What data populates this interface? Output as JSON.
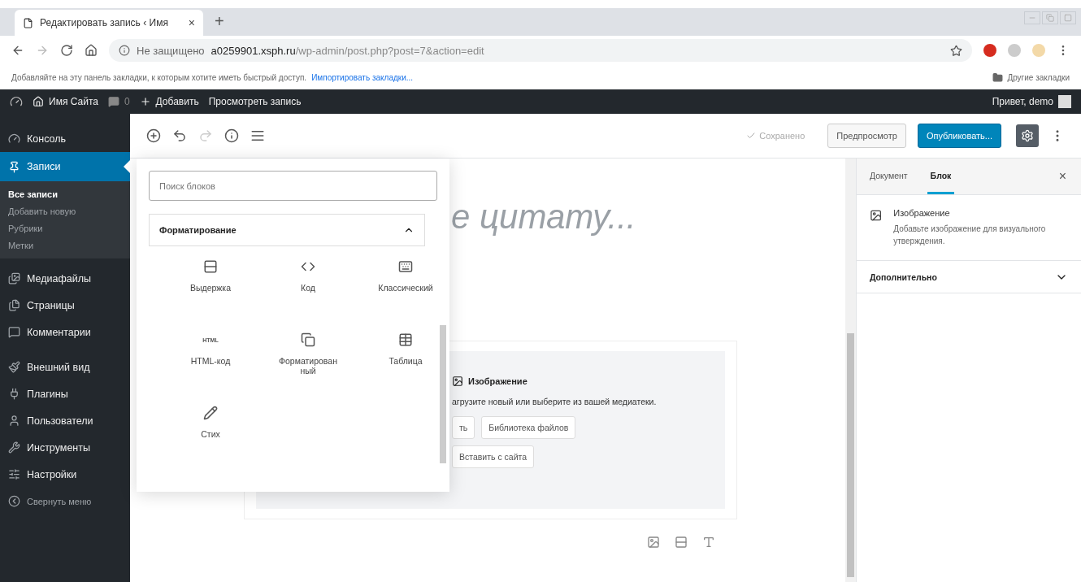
{
  "browser": {
    "tab": {
      "title": "Редактировать запись ‹ Имя",
      "close": "×",
      "selected": true
    },
    "new_tab": "+",
    "address": {
      "security": "Не защищено",
      "host": "a0259901.xsph.ru",
      "path": "/wp-admin/post.php?post=7&action=edit"
    },
    "bookmarks_bar": {
      "hint": "Добавляйте на эту панель закладки, к которым хотите иметь быстрый доступ.",
      "link": "Импортировать закладки...",
      "other": "Другие закладки"
    }
  },
  "admin_bar": {
    "site": "Имя Сайта",
    "comments": "0",
    "new": "Добавить",
    "view": "Просмотреть запись",
    "greeting": "Привет, demo"
  },
  "menu": [
    {
      "label": "Консоль",
      "selected": false
    },
    {
      "label": "Записи",
      "selected": true,
      "children": [
        {
          "label": "Все записи",
          "selected": true
        },
        {
          "label": "Добавить новую",
          "selected": false
        },
        {
          "label": "Рубрики",
          "selected": false
        },
        {
          "label": "Метки",
          "selected": false
        }
      ]
    },
    {
      "label": "Медиафайлы",
      "selected": false
    },
    {
      "label": "Страницы",
      "selected": false
    },
    {
      "label": "Комментарии",
      "selected": false
    },
    {
      "label": "Внешний вид",
      "selected": false
    },
    {
      "label": "Плагины",
      "selected": false
    },
    {
      "label": "Пользователи",
      "selected": false
    },
    {
      "label": "Инструменты",
      "selected": false
    },
    {
      "label": "Настройки",
      "selected": false
    }
  ],
  "collapse_menu": "Свернуть меню",
  "toolbar": {
    "saved": "Сохранено",
    "preview": "Предпросмотр",
    "publish": "Опубликовать..."
  },
  "inserter": {
    "search_placeholder": "Поиск блоков",
    "section": {
      "title": "Форматирование",
      "expanded": true
    },
    "blocks": [
      {
        "label": "Выдержка"
      },
      {
        "label": "Код"
      },
      {
        "label": "Классический"
      },
      {
        "label": "HTML-код",
        "glyph": "HTML"
      },
      {
        "label": "Форматированный"
      },
      {
        "label": "Таблица"
      },
      {
        "label": "Стих"
      }
    ]
  },
  "editor": {
    "quote_placeholder": "е цитату...",
    "image_block": {
      "title": "Изображение",
      "instructions": "агрузите новый или выберите из вашей медиатеки.",
      "buttons": [
        "ть",
        "Библиотека файлов",
        "Вставить с сайта"
      ]
    }
  },
  "settings_sidebar": {
    "tabs": [
      {
        "label": "Документ",
        "selected": false
      },
      {
        "label": "Блок",
        "selected": true
      }
    ],
    "close": "×",
    "block": {
      "title": "Изображение",
      "description": "Добавьте изображение для визуального утверждения."
    },
    "panel": {
      "title": "Дополнительно",
      "expanded": false
    }
  }
}
